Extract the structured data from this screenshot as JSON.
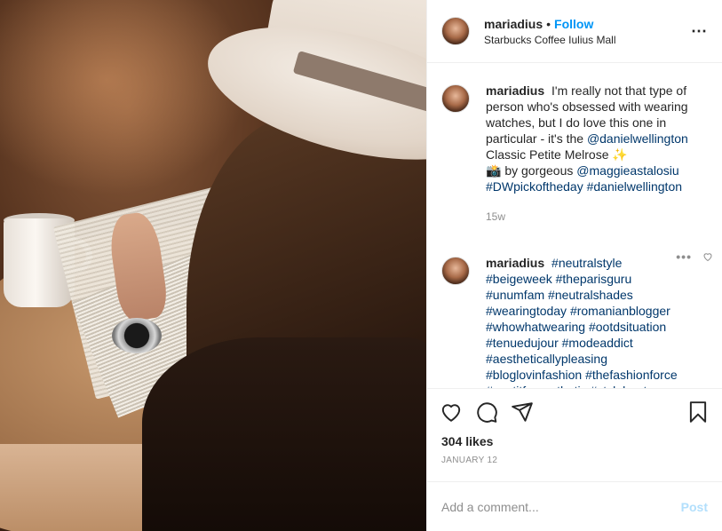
{
  "header": {
    "username": "mariadius",
    "separator": "•",
    "follow_label": "Follow",
    "location": "Starbucks Coffee Iulius Mall",
    "more_icon": "⋯"
  },
  "caption": {
    "username": "mariadius",
    "text1": "I'm really not that type of person who's obsessed with wearing watches, but I do love this one in particular - it's the",
    "mention1": "@danielwellington",
    "text2": "Classic Petite Melrose ✨",
    "text3": "📸 by gorgeous",
    "mention2": "@maggieastalosiu",
    "tag1": "#DWpickoftheday",
    "tag2": "#danielwellington",
    "ago": "15w"
  },
  "comment2": {
    "username": "mariadius",
    "tags": "#neutralstyle #beigeweek #theparisguru #unumfam #neutralshades #wearingtoday #romanianblogger #whowhatwearing #ootdsituation #tenuedujour #modeaddict #aestheticallypleasing #bloglovinfashion #thefashionforce #postitforaesthetic #stylehunters #anotheroutfitpost #outfitdujour #thefashionistasdiary",
    "more_icon": "•••"
  },
  "actions": {
    "like_icon": "heart-icon",
    "comment_icon": "comment-icon",
    "share_icon": "paper-plane-icon",
    "save_icon": "bookmark-icon"
  },
  "likes": "304 likes",
  "date": "JANUARY 12",
  "add_comment": {
    "placeholder": "Add a comment...",
    "post_label": "Post"
  },
  "colors": {
    "link": "#00376b",
    "follow": "#0095f6",
    "post_disabled": "#b2dffc",
    "muted": "#8e8e8e"
  }
}
